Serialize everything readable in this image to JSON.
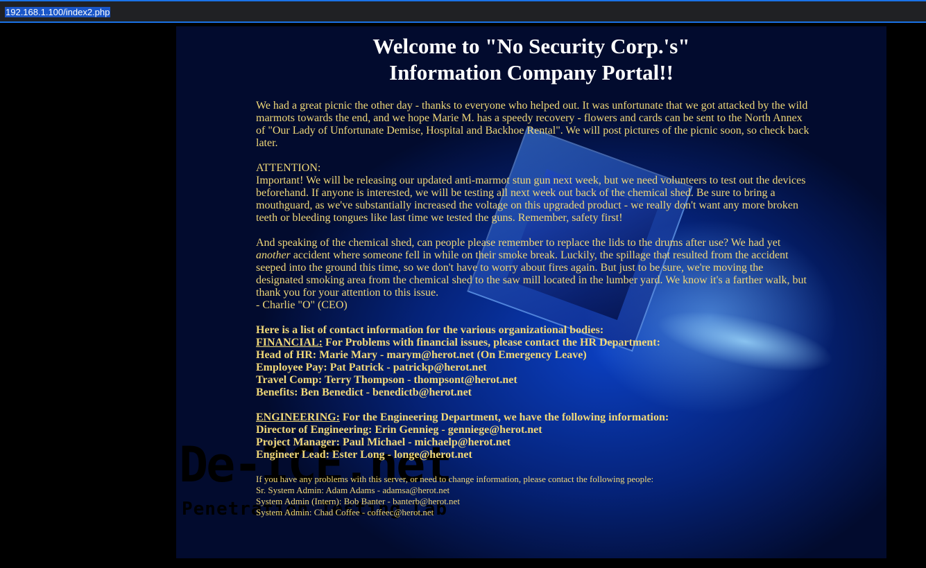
{
  "browser": {
    "url": "192.168.1.100/index2.php"
  },
  "header": {
    "line1": "Welcome to \"No Security Corp.'s\"",
    "line2": "Information Company Portal!!"
  },
  "news": {
    "picnic": "We had a great picnic the other day - thanks to everyone who helped out. It was unfortunate that we got attacked by the wild marmots towards the end, and we hope Marie M. has a speedy recovery - flowers and cards can be sent to the North Annex of \"Our Lady of Unfortunate Demise, Hospital and Backhoe Rental\". We will post pictures of the picnic soon, so check back later.",
    "attention_label": "ATTENTION:",
    "attention_body": "Important! We will be releasing our updated anti-marmot stun gun next week, but we need volunteers to test out the devices beforehand. If anyone is interested, we will be testing all next week out back of the chemical shed. Be sure to bring a mouthguard, as we've substantially increased the voltage on this upgraded product - we really don't want any more broken teeth or bleeding tongues like last time we tested the guns. Remember, safety first!",
    "shed_start": "And speaking of the chemical shed, can people please remember to replace the lids to the drums after use? We had yet ",
    "shed_italic": "another",
    "shed_rest": " accident where someone fell in while on their smoke break. Luckily, the spillage that resulted from the accident seeped into the ground this time, so we don't have to worry about fires again. But just to be sure, we're moving the designated smoking area from the chemical shed to the saw mill located in the lumber yard. We know it's a farther walk, but thank you for your attention to this issue.",
    "signature": "- Charlie \"O\" (CEO)"
  },
  "contacts": {
    "intro": "Here is a list of contact information for the various organizational bodies:",
    "financial": {
      "label": "FINANCIAL:",
      "desc": " For Problems with financial issues, please contact the HR Department:",
      "items": [
        "Head of HR: Marie Mary - marym@herot.net (On Emergency Leave)",
        "Employee Pay: Pat Patrick - patrickp@herot.net",
        "Travel Comp: Terry Thompson - thompsont@herot.net",
        "Benefits: Ben Benedict - benedictb@herot.net"
      ]
    },
    "engineering": {
      "label": "ENGINEERING:",
      "desc": " For the Engineering Department, we have the following information:",
      "items": [
        "Director of Engineering: Erin Gennieg - genniege@herot.net",
        "Project Manager: Paul Michael - michaelp@herot.net",
        "Engineer Lead: Ester Long - longe@herot.net"
      ]
    }
  },
  "admins": {
    "intro": "If you have any problems with this server, or need to change information, please contact the following people:",
    "items": [
      "Sr. System Admin: Adam Adams - adamsa@herot.net",
      "System Admin (Intern): Bob Banter - banterb@herot.net",
      "System Admin: Chad Coffee - coffeec@herot.net"
    ]
  },
  "logo": {
    "big": "De-ICE.net",
    "small": "Penetration Testing Lab"
  },
  "colors": {
    "text": "#f0d878",
    "heading": "#ffffff",
    "accent": "#1a73e8"
  }
}
